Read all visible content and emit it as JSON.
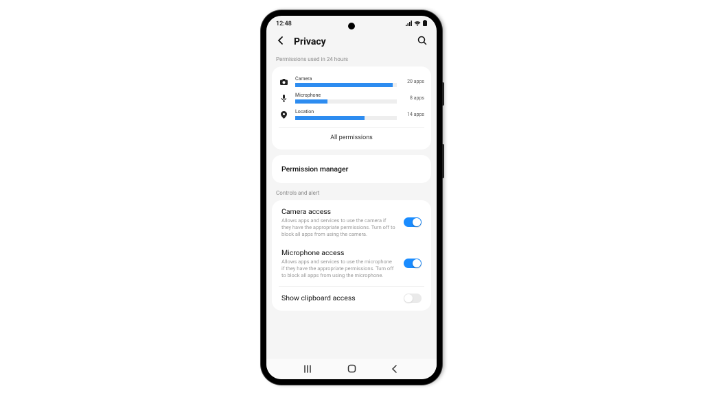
{
  "status": {
    "time": "12:48"
  },
  "header": {
    "title": "Privacy"
  },
  "usage": {
    "section_label": "Permissions used in 24 hours",
    "all_link": "All permissions",
    "rows": [
      {
        "name": "Camera",
        "count": "20 apps",
        "fill": 96
      },
      {
        "name": "Microphone",
        "count": "8 apps",
        "fill": 32
      },
      {
        "name": "Location",
        "count": "14 apps",
        "fill": 68
      }
    ]
  },
  "menu": {
    "permission_manager": "Permission manager"
  },
  "controls": {
    "section_label": "Controls and alert",
    "camera": {
      "title": "Camera access",
      "desc": "Allows apps and services to use the camera if they have the appropriate permissions. Turn off to block all apps from using the camera.",
      "on": true
    },
    "microphone": {
      "title": "Microphone access",
      "desc": "Allows apps and services to use the microphone if they have the appropriate permissions. Turn off to block all apps from using the microphone.",
      "on": true
    },
    "clipboard": {
      "title": "Show clipboard access"
    }
  }
}
